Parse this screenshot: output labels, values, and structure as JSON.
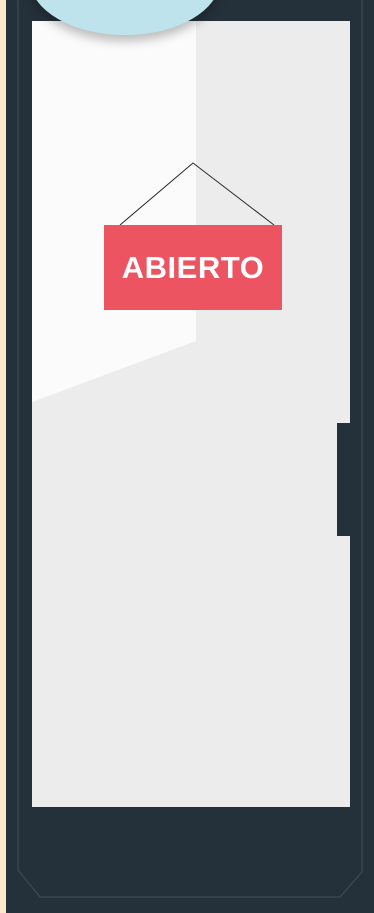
{
  "sign": {
    "label": "ABIERTO"
  },
  "colors": {
    "background": "#fbe9cc",
    "frame": "#25313a",
    "door": "#ececec",
    "sign": "#ec5461",
    "sign_text": "#ffffff",
    "lamp": "#bfe3ec"
  }
}
